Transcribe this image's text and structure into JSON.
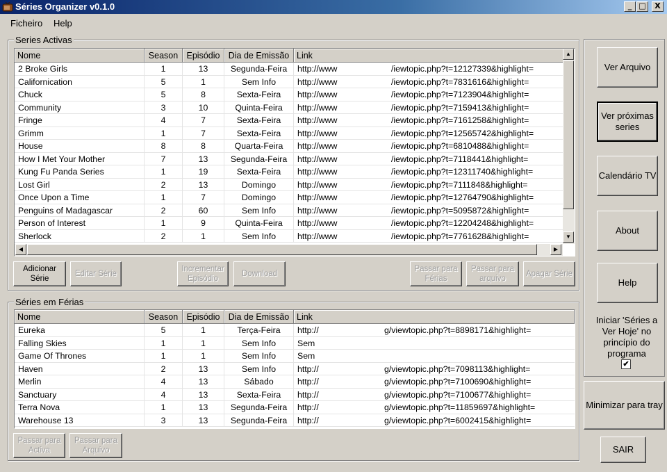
{
  "window": {
    "title": "Séries Organizer  v0.1.0",
    "minimize": "_",
    "maximize": "□",
    "close": "X"
  },
  "menu": [
    "Ficheiro",
    "Help"
  ],
  "active": {
    "group_label": "Series Activas",
    "columns": [
      "Nome",
      "Season",
      "Episódio",
      "Dia de Emissão",
      "Link"
    ],
    "rows": [
      [
        "2 Broke Girls",
        "1",
        "13",
        "Segunda-Feira",
        "http://www",
        "/iewtopic.php?t=12127339&highlight="
      ],
      [
        "Californication",
        "5",
        "1",
        "Sem Info",
        "http://www",
        "/iewtopic.php?t=7831616&highlight="
      ],
      [
        "Chuck",
        "5",
        "8",
        "Sexta-Feira",
        "http://www",
        "/iewtopic.php?t=7123904&highlight="
      ],
      [
        "Community",
        "3",
        "10",
        "Quinta-Feira",
        "http://www",
        "/iewtopic.php?t=7159413&highlight="
      ],
      [
        "Fringe",
        "4",
        "7",
        "Sexta-Feira",
        "http://www",
        "/iewtopic.php?t=7161258&highlight="
      ],
      [
        "Grimm",
        "1",
        "7",
        "Sexta-Feira",
        "http://www",
        "/iewtopic.php?t=12565742&highlight="
      ],
      [
        "House",
        "8",
        "8",
        "Quarta-Feira",
        "http://www",
        "/iewtopic.php?t=6810488&highlight="
      ],
      [
        "How I Met Your Mother",
        "7",
        "13",
        "Segunda-Feira",
        "http://www",
        "/iewtopic.php?t=7118441&highlight="
      ],
      [
        "Kung Fu Panda Series",
        "1",
        "19",
        "Sexta-Feira",
        "http://www",
        "/iewtopic.php?t=12311740&highlight="
      ],
      [
        "Lost Girl",
        "2",
        "13",
        "Domingo",
        "http://www",
        "/iewtopic.php?t=7111848&highlight="
      ],
      [
        "Once Upon a Time",
        "1",
        "7",
        "Domingo",
        "http://www",
        "/iewtopic.php?t=12764790&highlight="
      ],
      [
        "Penguins of Madagascar",
        "2",
        "60",
        "Sem Info",
        "http://www",
        "/iewtopic.php?t=5095872&highlight="
      ],
      [
        "Person of Interest",
        "1",
        "9",
        "Quinta-Feira",
        "http://www",
        "/iewtopic.php?t=12204248&highlight="
      ],
      [
        "Sherlock",
        "2",
        "1",
        "Sem Info",
        "http://www",
        "/iewtopic.php?t=7761628&highlight="
      ]
    ],
    "buttons": {
      "add": "Adicionar Série",
      "edit": "Editar Série",
      "increment": "Incrementar Episódio",
      "download": "Download",
      "to_vacation": "Passar para Férias",
      "to_archive": "Passar para arquivo",
      "delete": "Apagar Série"
    }
  },
  "vacation": {
    "group_label": "Séries em Férias",
    "columns": [
      "Nome",
      "Season",
      "Episódio",
      "Dia de Emissão",
      "Link"
    ],
    "rows": [
      [
        "Eureka",
        "5",
        "1",
        "Terça-Feira",
        "http://",
        "g/viewtopic.php?t=8898171&highlight="
      ],
      [
        "Falling Skies",
        "1",
        "1",
        "Sem Info",
        "Sem",
        ""
      ],
      [
        "Game Of Thrones",
        "1",
        "1",
        "Sem Info",
        "Sem",
        ""
      ],
      [
        "Haven",
        "2",
        "13",
        "Sem Info",
        "http://",
        "g/viewtopic.php?t=7098113&highlight="
      ],
      [
        "Merlin",
        "4",
        "13",
        "Sábado",
        "http://",
        "g/viewtopic.php?t=7100690&highlight="
      ],
      [
        "Sanctuary",
        "4",
        "13",
        "Sexta-Feira",
        "http://",
        "g/viewtopic.php?t=7100677&highlight="
      ],
      [
        "Terra Nova",
        "1",
        "13",
        "Segunda-Feira",
        "http://",
        "g/viewtopic.php?t=11859697&highlight="
      ],
      [
        "Warehouse 13",
        "3",
        "13",
        "Segunda-Feira",
        "http://",
        "g/viewtopic.php?t=6002415&highlight="
      ]
    ],
    "buttons": {
      "to_active": "Passar para Activa",
      "to_archive": "Passar para Arquivo"
    }
  },
  "side": {
    "view_archive": "Ver Arquivo",
    "next_series": "Ver próximas series",
    "calendar": "Calendário TV",
    "about": "About",
    "help": "Help",
    "startup_label": "Iniciar 'Séries a Ver Hoje' no princípio do programa",
    "startup_checked": "✔",
    "minimize_tray": "Minimizar para tray",
    "exit": "SAIR"
  }
}
